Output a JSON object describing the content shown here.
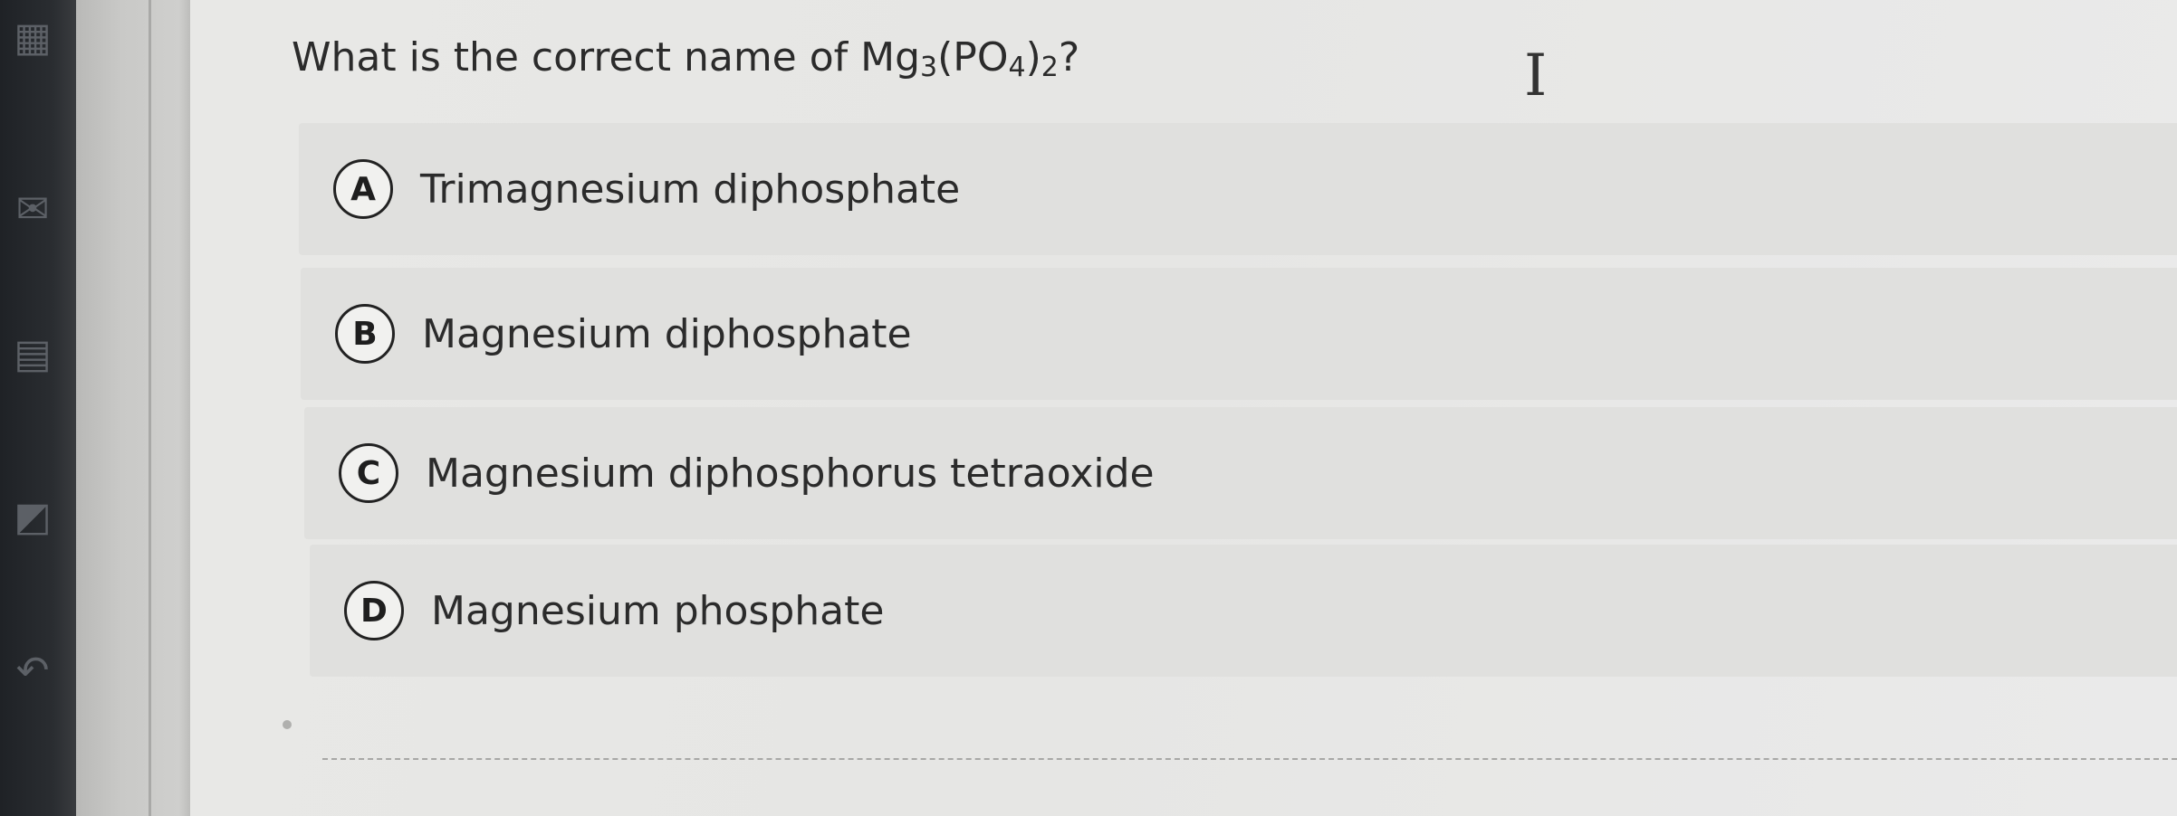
{
  "question": {
    "prefix": "What is the correct name of Mg",
    "sub1": "3",
    "mid": "(PO",
    "sub2": "4",
    "close": ")",
    "sub3": "2",
    "suffix": "?"
  },
  "options": [
    {
      "letter": "A",
      "label": "Trimagnesium diphosphate"
    },
    {
      "letter": "B",
      "label": "Magnesium diphosphate"
    },
    {
      "letter": "C",
      "label": "Magnesium diphosphorus tetraoxide"
    },
    {
      "letter": "D",
      "label": "Magnesium phosphate"
    }
  ],
  "cursor": {
    "glyph": "I"
  },
  "sidebar": {
    "icons": [
      "grid-icon",
      "mail-icon",
      "notes-icon",
      "edit-icon",
      "back-icon"
    ]
  }
}
